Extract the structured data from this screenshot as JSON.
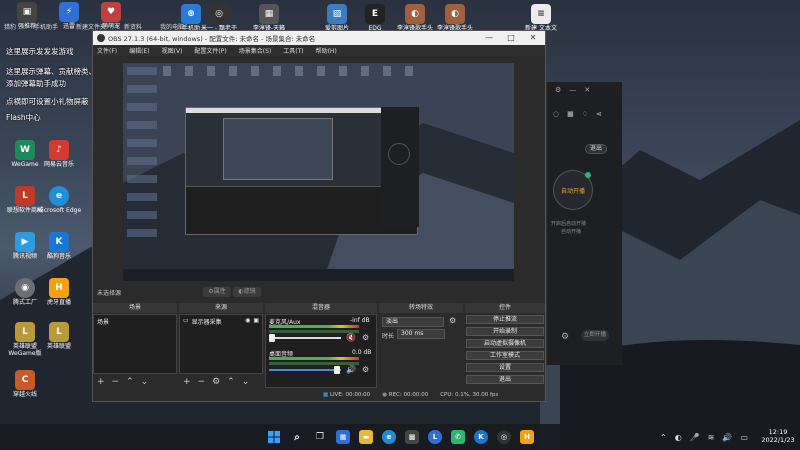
{
  "desktop": {
    "top_labels": [
      "强推荐",
      "迅雷",
      "萌萌宠"
    ],
    "top_row_labels": [
      "猎豹",
      "手机助手",
      "新建文件夹",
      "新资料",
      "我的电脑"
    ],
    "top_icons": [
      "手机助",
      "米一 - 飘老于",
      "李淳锋-天籁",
      "爱剪图片",
      "EDG",
      "李淳锋歌手头",
      "李淳锋歌手头",
      "新建 文本文"
    ],
    "notes": [
      "这里展示发发发游戏",
      "这里展示弹幕、贡献榜类、粉丝牌升级等",
      "添加弹幕助手成功",
      "点横即可设置小礼物屏蔽",
      "Flash中心"
    ],
    "icons": [
      {
        "label": "WeGame",
        "color": "#1e8a5b",
        "glyph": "W"
      },
      {
        "label": "网易云音乐",
        "color": "#d33a32",
        "glyph": "♪"
      },
      {
        "label": "联想软件商城",
        "color": "#c0392b",
        "glyph": "L"
      },
      {
        "label": "Microsoft Edge",
        "color": "#1f8fd6",
        "glyph": "e"
      },
      {
        "label": "腾讯视频",
        "color": "#2f9ae0",
        "glyph": "▶"
      },
      {
        "label": "酷狗音乐",
        "color": "#1976d2",
        "glyph": "K"
      },
      {
        "label": "腾式工厂",
        "color": "#6c6f75",
        "glyph": "◉"
      },
      {
        "label": "虎牙直播",
        "color": "#f2a20f",
        "glyph": "H"
      },
      {
        "label": "英雄联盟 WeGame版",
        "color": "#b89a3a",
        "glyph": "L"
      },
      {
        "label": "英雄联盟",
        "color": "#b89a3a",
        "glyph": "L"
      },
      {
        "label": "穿越火线",
        "color": "#c85a2a",
        "glyph": "C"
      }
    ]
  },
  "obs": {
    "title": "OBS 27.1.3 (64-bit, windows) - 配置文件: 未命名 - 场景集合: 未命名",
    "menu": [
      "文件(F)",
      "编辑(E)",
      "视图(V)",
      "配置文件(P)",
      "场景集合(S)",
      "工具(T)",
      "帮助(H)"
    ],
    "no_source": "未选择源",
    "props_label": "属性",
    "filters_label": "滤镜",
    "panels": {
      "scenes": "场景",
      "sources": "来源",
      "mixer": "混音器",
      "transitions": "转场特效",
      "controls": "控件"
    },
    "scene_item": "场景",
    "source_item": "显示器采集",
    "mixer": [
      {
        "name": "麦克风/Aux",
        "db": "-inf dB"
      },
      {
        "name": "桌面音频",
        "db": "0.0 dB"
      }
    ],
    "transition": {
      "type": "淡出",
      "duration_label": "时长",
      "duration": "300 ms"
    },
    "controls": [
      "停止推流",
      "开始录制",
      "启动虚拟摄像机",
      "工作室模式",
      "设置",
      "退出"
    ],
    "status": {
      "live": "LIVE: 00:00:00",
      "rec": "REC: 00:00:00",
      "cpu": "CPU: 0.1%, 30.00 fps"
    }
  },
  "right_app": {
    "exit_btn": "退出",
    "circle_label": "自动开播",
    "hint": "开启后自动开播",
    "sub": "自动开播",
    "tail": "立即开播",
    "row": "设置 ·"
  },
  "taskbar": {
    "time": "12:19",
    "date": "2022/1/23"
  },
  "colors": {
    "obs_panel": "#1f1f1f",
    "accent_blue": "#1f8fd6"
  }
}
